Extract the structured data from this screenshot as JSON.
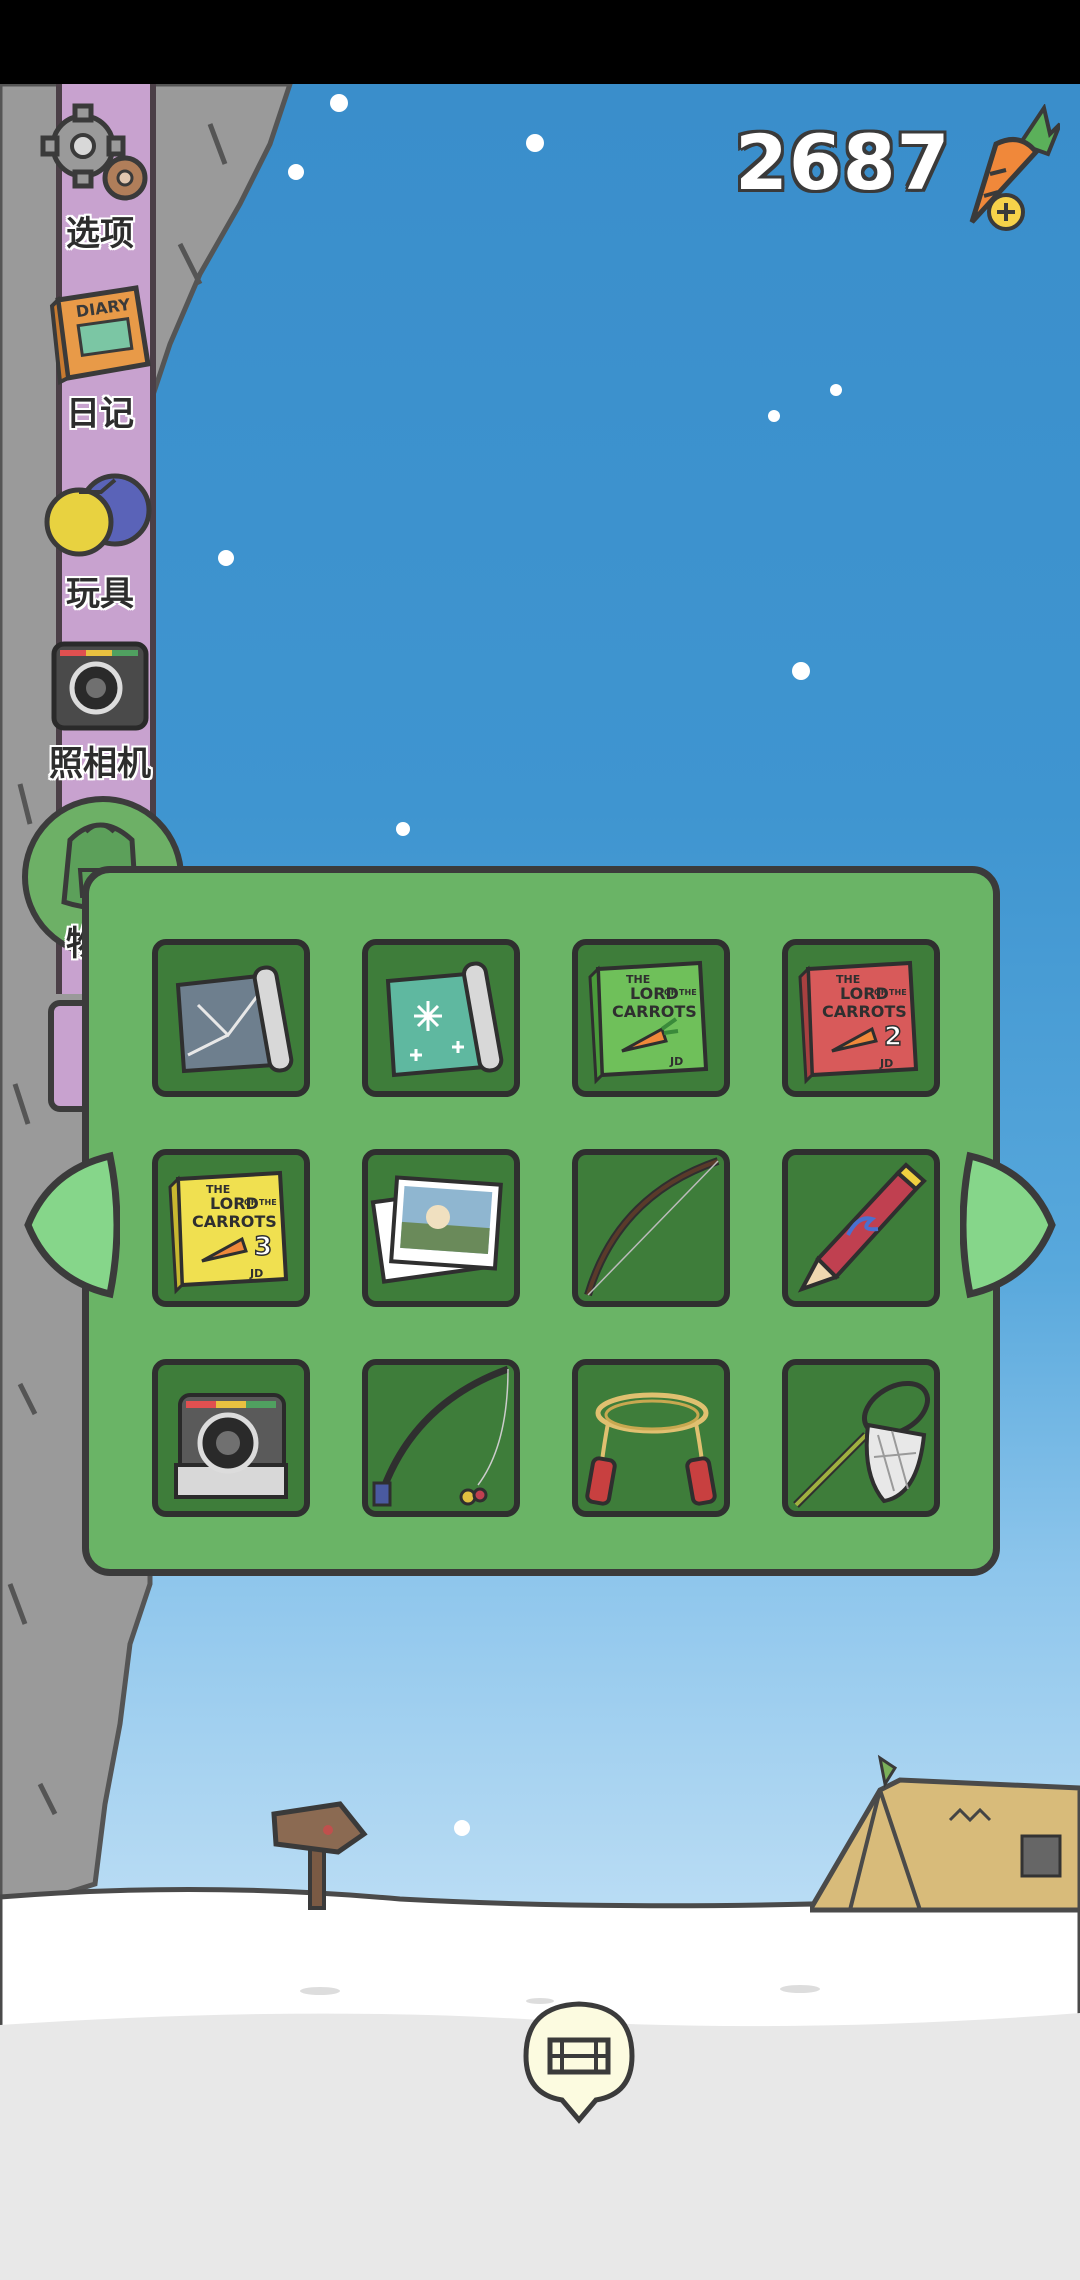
{
  "currency": {
    "count": "2687",
    "icon": "carrot-add-icon"
  },
  "sidebar": {
    "items": [
      {
        "label": "选项",
        "icon": "gear-icon"
      },
      {
        "label": "日记",
        "icon": "diary-icon",
        "icon_text": "DIARY"
      },
      {
        "label": "玩具",
        "icon": "toys-icon"
      },
      {
        "label": "照相机",
        "icon": "camera-icon"
      },
      {
        "label": "物品",
        "icon": "backpack-icon"
      }
    ]
  },
  "inventory": {
    "items": [
      {
        "name": "map-scroll",
        "icon": "map-scroll-icon"
      },
      {
        "name": "snow-map-scroll",
        "icon": "snow-scroll-icon"
      },
      {
        "name": "book-green",
        "icon": "book-icon"
      },
      {
        "name": "book-red-2",
        "icon": "book-icon",
        "volume": "2"
      },
      {
        "name": "book-yellow-3",
        "icon": "book-icon",
        "volume": "3"
      },
      {
        "name": "photos",
        "icon": "photos-icon"
      },
      {
        "name": "bow",
        "icon": "bow-icon"
      },
      {
        "name": "pencil",
        "icon": "pencil-icon"
      },
      {
        "name": "camera",
        "icon": "camera-icon"
      },
      {
        "name": "fishing-rod",
        "icon": "fishing-rod-icon"
      },
      {
        "name": "jump-rope",
        "icon": "jump-rope-icon"
      },
      {
        "name": "bug-net",
        "icon": "bug-net-icon"
      }
    ],
    "book_cover": [
      "THE",
      "LORD",
      "OF THE",
      "CARROTS",
      "JD"
    ]
  },
  "navigation": {
    "prev": "arrow-left-icon",
    "next": "arrow-right-icon",
    "home": "home-icon"
  },
  "colors": {
    "panel": "#6ab466",
    "slot": "#3e7d3a",
    "sky": "#3f95d0",
    "strip": "#c8a2cf"
  }
}
